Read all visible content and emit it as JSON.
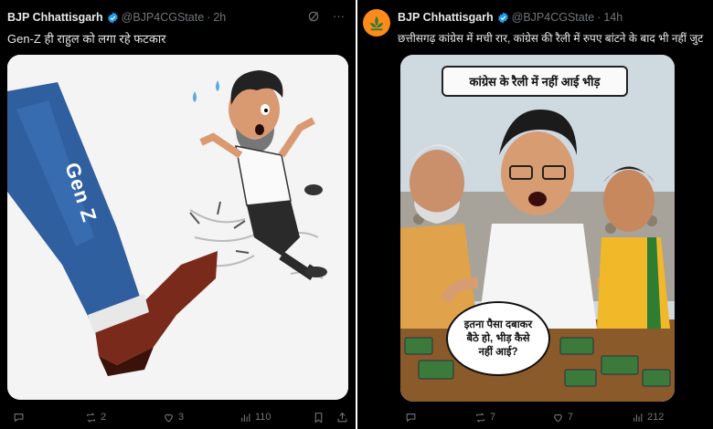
{
  "left_post": {
    "author": "BJP Chhattisgarh",
    "handle": "@BJP4CGState",
    "time": "2h",
    "caption": "Gen-Z ही राहुल को लगा रहे फटकार",
    "media": {
      "label": "Gen Z"
    },
    "actions": {
      "replies": "",
      "reposts": "2",
      "likes": "3",
      "views": "110"
    }
  },
  "right_post": {
    "author": "BJP Chhattisgarh",
    "handle": "@BJP4CGState",
    "time": "14h",
    "caption": "छत्तीसगढ़ कांग्रेस में मची रार, कांग्रेस की रैली में रुपए बांटने के बाद भी नहीं जुट रही",
    "media": {
      "banner": "कांग्रेस के रैली में नहीं आई भीड़",
      "speech_line1": "इतना पैसा दबाकर",
      "speech_line2": "बैठे हो, भीड़ कैसे",
      "speech_line3": "नहीं आई?"
    },
    "actions": {
      "replies": "",
      "reposts": "7",
      "likes": "7",
      "views": "212"
    }
  },
  "colors": {
    "background": "#000000",
    "text": "#e7e9ea",
    "muted": "#71767b",
    "verified": "#1d9bf0",
    "bjp_orange": "#ff8a1c"
  },
  "icons": [
    "verified-badge-icon",
    "grok-icon",
    "more-icon",
    "reply-icon",
    "repost-icon",
    "like-icon",
    "views-icon",
    "bookmark-icon",
    "share-icon",
    "bjp-lotus-icon"
  ]
}
